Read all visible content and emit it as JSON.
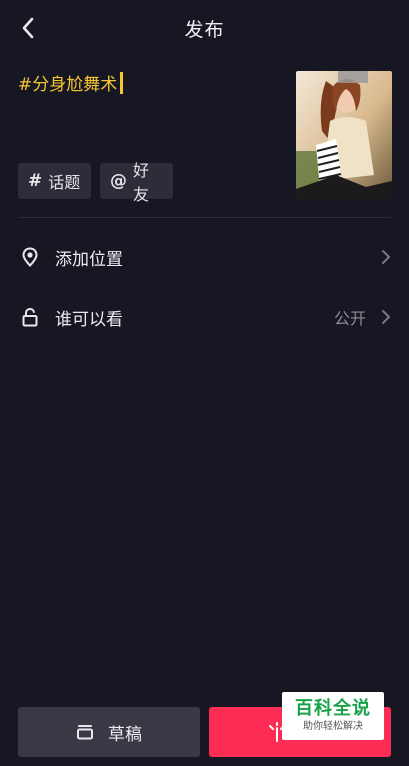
{
  "header": {
    "title": "发布",
    "back_icon": "chevron-left-icon"
  },
  "caption": {
    "text": "#分身尬舞术"
  },
  "thumbnail": {
    "description_icon": "video-cover-thumbnail"
  },
  "chips": [
    {
      "symbol": "#",
      "label": "话题"
    },
    {
      "symbol": "@",
      "label": "好友"
    }
  ],
  "rows": {
    "location": {
      "label": "添加位置",
      "icon": "location-pin-icon"
    },
    "visibility": {
      "label": "谁可以看",
      "value": "公开",
      "icon": "unlock-icon"
    }
  },
  "footer": {
    "draft_label": "草稿",
    "publish_label": ""
  },
  "watermark": {
    "title": "百科全说",
    "subtitle": "助你轻松解决"
  },
  "colors": {
    "background": "#161722",
    "accent_yellow": "#f7c531",
    "publish_red": "#fd2c55",
    "chip_bg": "#2c2d38"
  }
}
